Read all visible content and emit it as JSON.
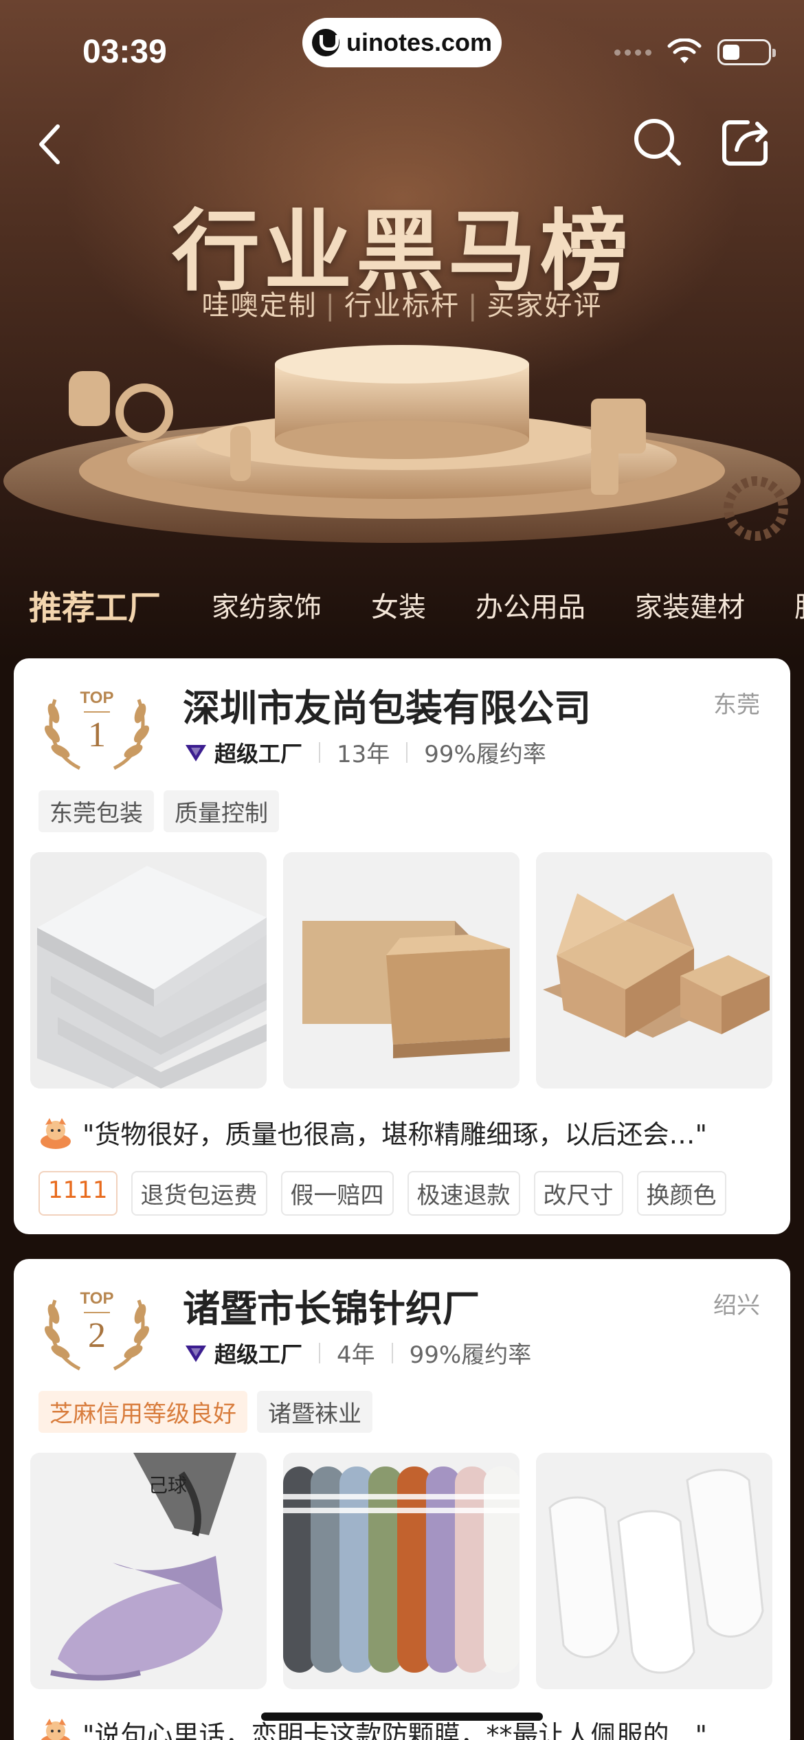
{
  "status": {
    "time": "03:39"
  },
  "watermark": {
    "text": "uinotes.com"
  },
  "hero": {
    "title": "行业黑马榜",
    "subtitle": [
      "哇噢定制",
      "行业标杆",
      "买家好评"
    ]
  },
  "tabs": [
    "推荐工厂",
    "家纺家饰",
    "女装",
    "办公用品",
    "家装建材",
    "肥"
  ],
  "factories": [
    {
      "rank_top": "TOP",
      "rank": "1",
      "name": "深圳市友尚包装有限公司",
      "city": "东莞",
      "badge": "超级工厂",
      "years": "13年",
      "fulfillment": "99%履约率",
      "tags": [
        "东莞包装",
        "质量控制"
      ],
      "review": "\"货物很好，质量也很高，堪称精雕细琢，以后还会…\"",
      "services": [
        "1111",
        "退货包运费",
        "假一赔四",
        "极速退款",
        "改尺寸",
        "换颜色"
      ]
    },
    {
      "rank_top": "TOP",
      "rank": "2",
      "name": "诸暨市长锦针织厂",
      "city": "绍兴",
      "badge": "超级工厂",
      "years": "4年",
      "fulfillment": "99%履约率",
      "tags": [
        "芝麻信用等级良好",
        "诸暨袜业"
      ],
      "photo_text": "己球",
      "review": "\"说句心里话，恋明卡这款防颗膜，**最让人佩服的…\""
    }
  ],
  "colors": {
    "accent_gold": "#f3d5ae",
    "orange": "#e86a1c",
    "super_factory_purple": "#3b1d8f"
  },
  "icons": [
    "back-icon",
    "search-icon",
    "share-icon",
    "wifi-icon",
    "battery-icon",
    "laurel-icon",
    "super-factory-icon",
    "reviewer-avatar-icon"
  ]
}
